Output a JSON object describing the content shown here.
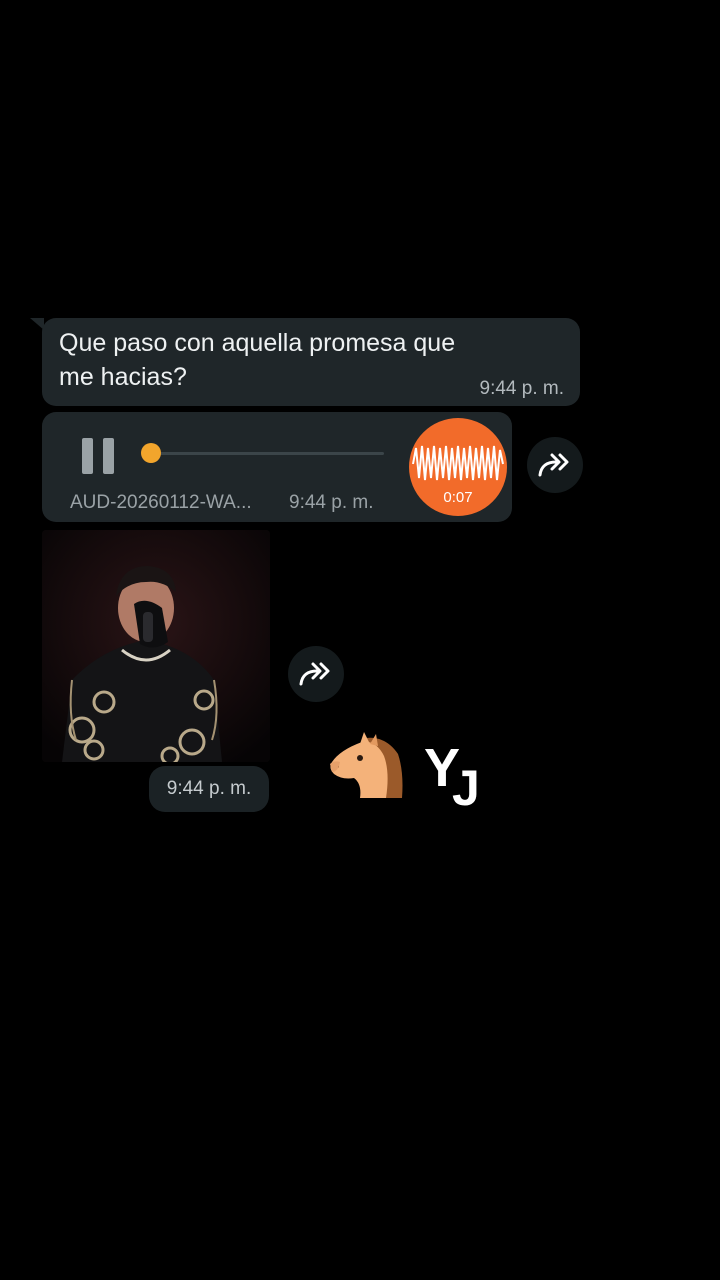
{
  "messages": {
    "text": {
      "body": "Que paso con aquella promesa que me hacias?",
      "time": "9:44 p. m."
    },
    "audio": {
      "file_name": "AUD-20260112-WA...",
      "time": "9:44 p. m.",
      "duration": "0:07",
      "state": "playing",
      "progress": 0.0,
      "accent_color": "#f2a52c",
      "avatar_color": "#f26b2a"
    },
    "image": {
      "time": "9:44 p. m."
    }
  },
  "icons": {
    "pause": "pause-icon",
    "forward": "forward-icon",
    "horse": "horse-emoji",
    "waveform": "waveform-icon"
  },
  "sticker": {
    "letter_y": "Y",
    "letter_j": "J"
  },
  "colors": {
    "background": "#000000",
    "bubble": "#1f2629",
    "text": "#eef1f2",
    "meta_text": "#9aa2a6"
  }
}
